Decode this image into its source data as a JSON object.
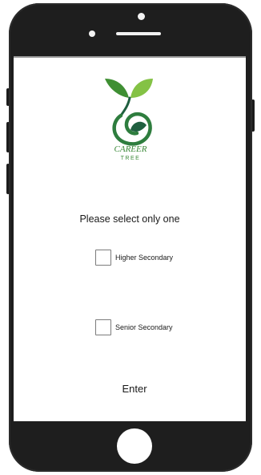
{
  "brand": {
    "name_line1": "CAREER",
    "name_line2": "TREE",
    "colors": {
      "green": "#3c9a3a",
      "dark_green": "#1f5f3f",
      "leaf_light": "#7fc241"
    }
  },
  "question": {
    "text": "Please select only one"
  },
  "options": [
    {
      "label": "Higher Secondary",
      "checked": false
    },
    {
      "label": "Senior Secondary",
      "checked": false
    }
  ],
  "enter_button": {
    "label": "Enter"
  },
  "icons": {
    "logo": "career-tree-logo",
    "home": "home-button",
    "camera": "front-camera",
    "speaker": "earpiece-speaker"
  }
}
